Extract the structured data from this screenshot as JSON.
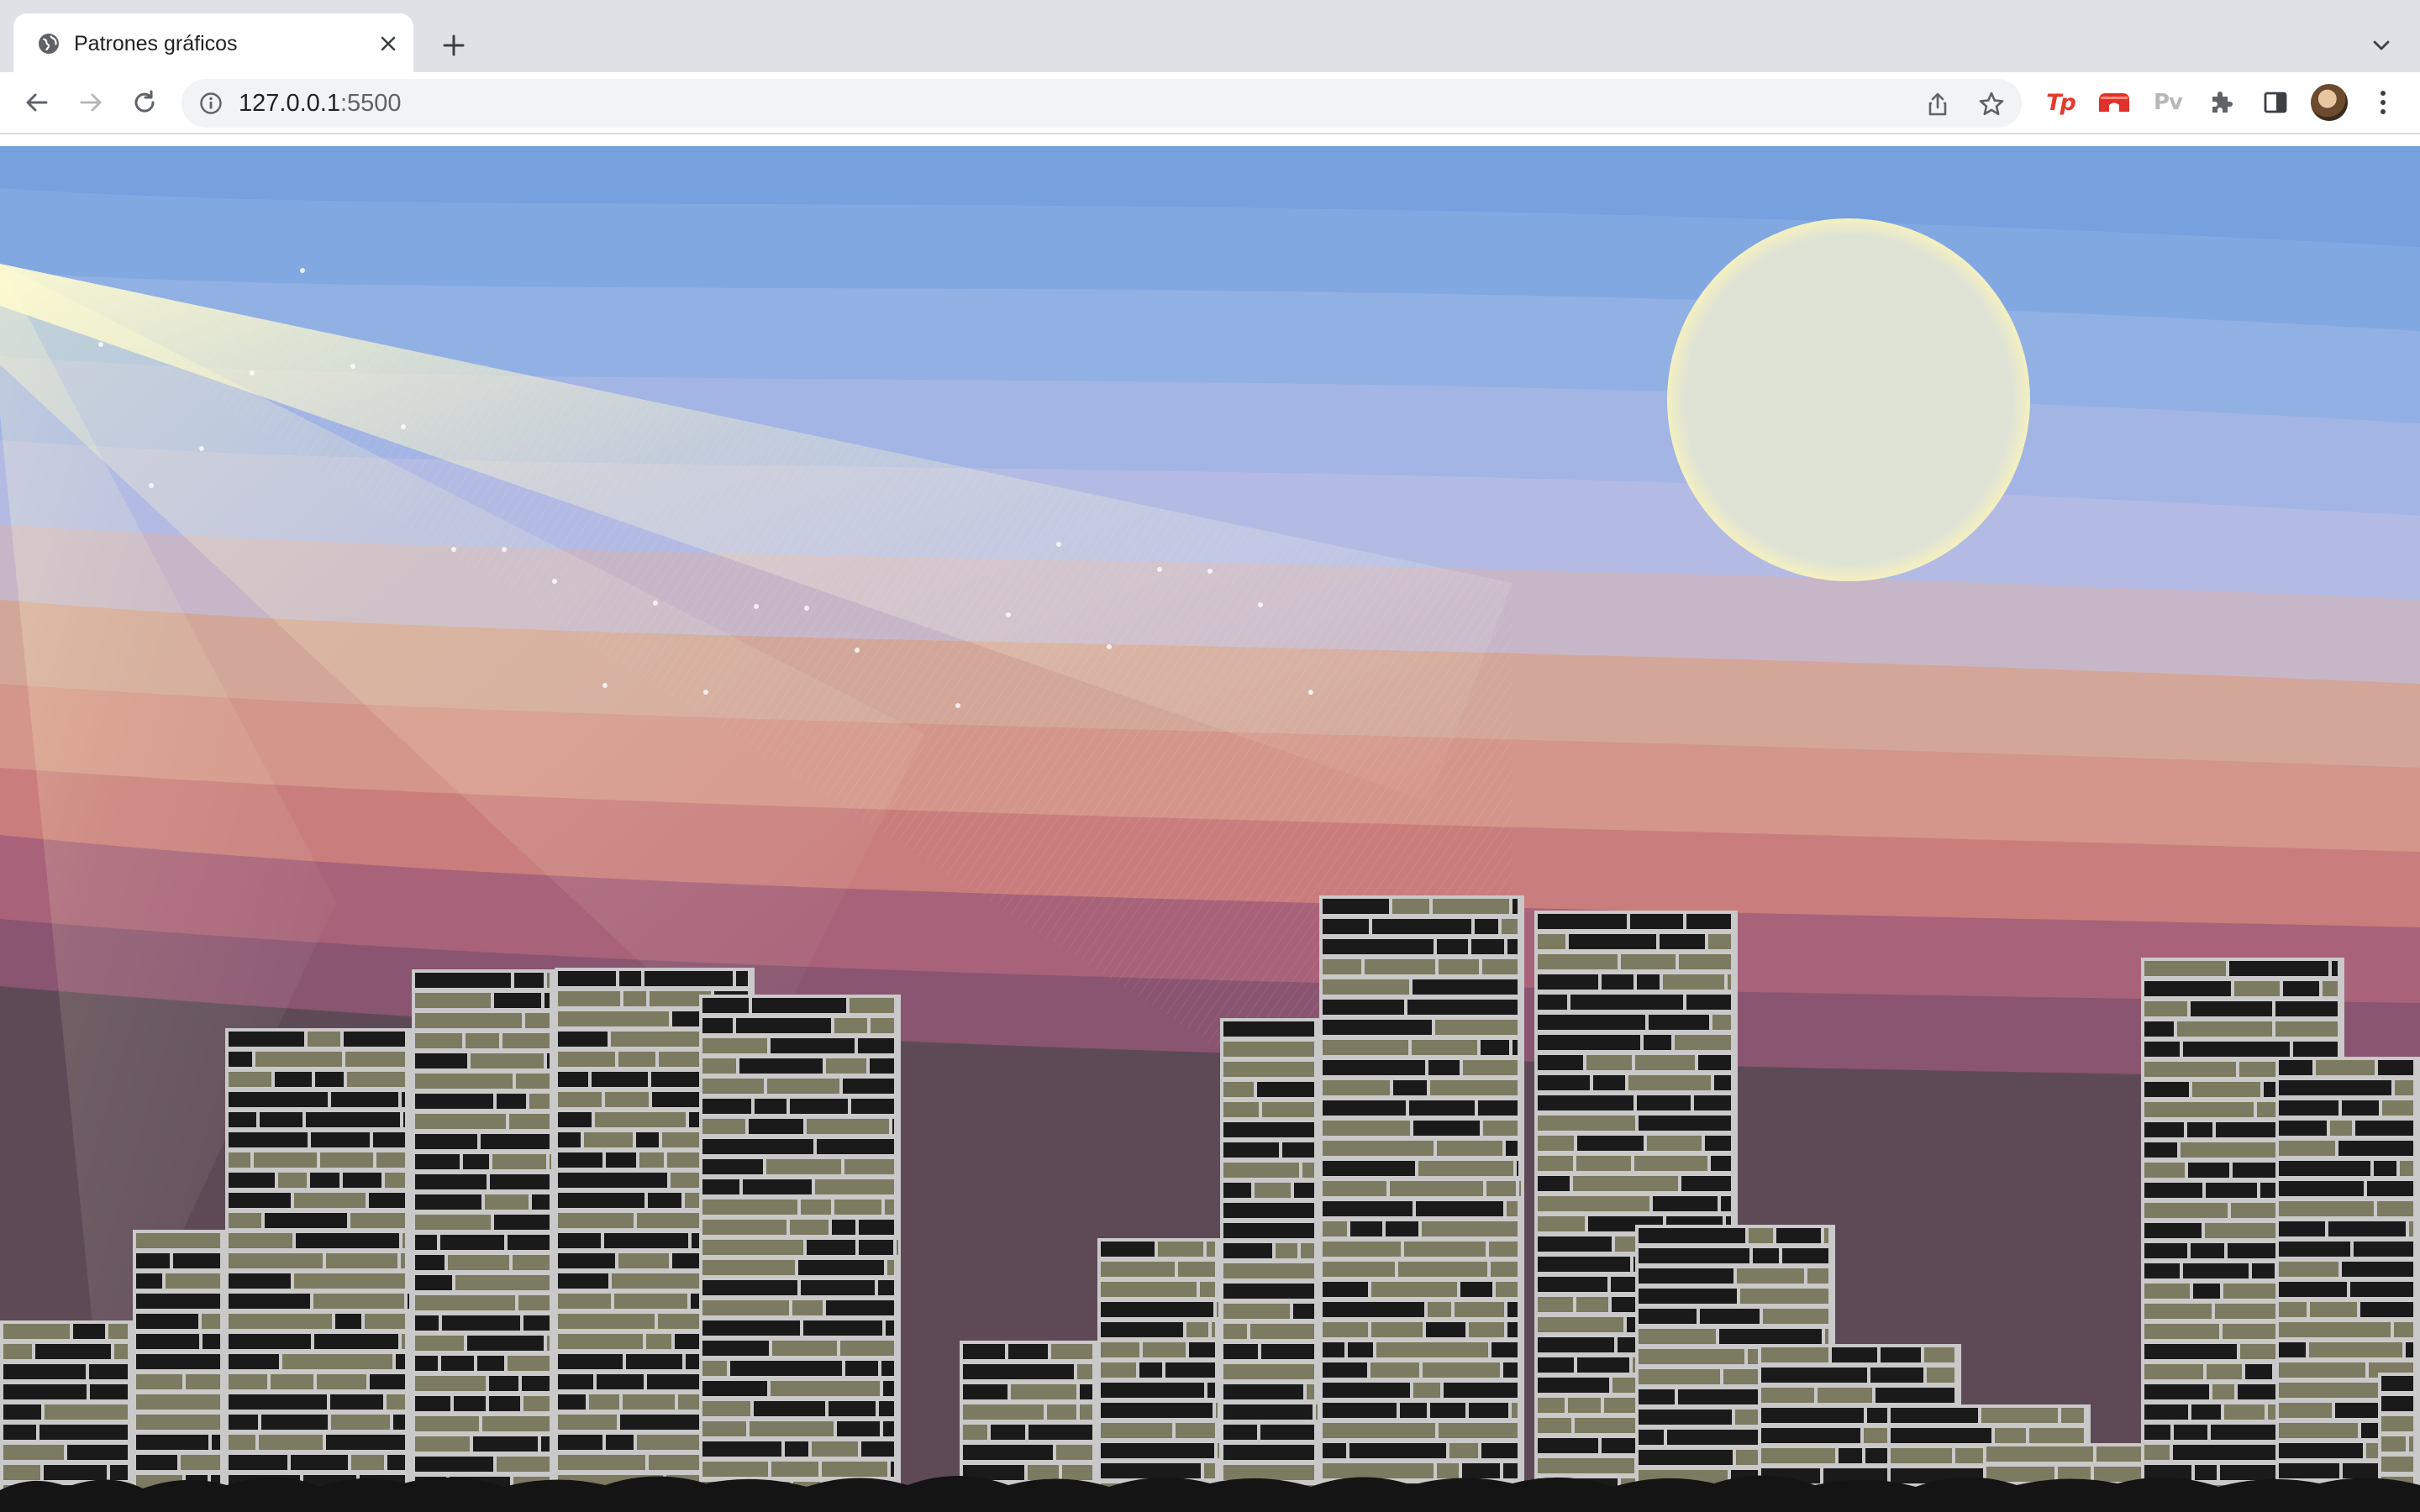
{
  "browser": {
    "tab": {
      "title": "Patrones gráficos",
      "icon": "globe-icon"
    },
    "address_bar": {
      "host": "127.0.0.1",
      "port": ":5500"
    },
    "toolbar_icons": [
      "back-icon",
      "forward-icon",
      "reload-icon",
      "info-icon",
      "share-icon",
      "bookmark-star-icon",
      "extension-tp-icon",
      "extension-red-icon",
      "extension-pv-icon",
      "extensions-puzzle-icon",
      "side-panel-icon",
      "profile-avatar",
      "menu-kebab-icon"
    ],
    "extensions": {
      "tp_label": "Tp",
      "pv_label": "Pv"
    }
  },
  "scene": {
    "description_colors": {
      "sky_top": "#76a0de",
      "sky_mid": "#a9b7e6",
      "sunset_peach": "#d8a08c",
      "sunset_rose": "#c8767c",
      "dusk_purple": "#8c4f74",
      "ground": "#5e4a57",
      "moon_fill": "#dfe3d6",
      "moon_ring": "#f4f0c0",
      "window_lit": "#7c7a60",
      "window_dark": "#1a1a1a"
    },
    "elements": [
      "sky-bands",
      "light-beam",
      "stars",
      "moon",
      "city-skyline"
    ]
  }
}
